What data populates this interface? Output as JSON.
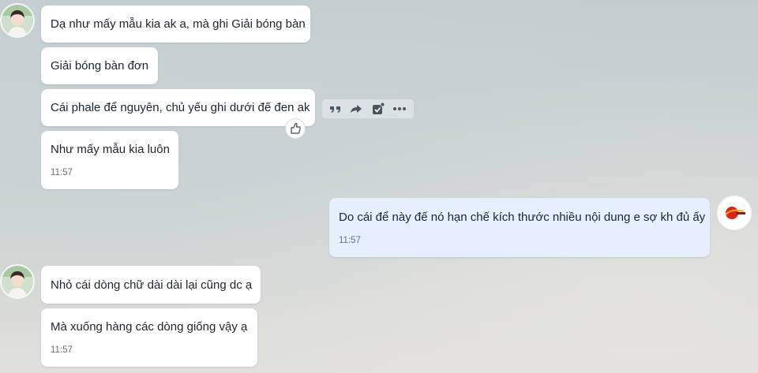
{
  "messages": [
    {
      "text": "Dạ như mấy mẫu kia ak a, mà ghi Giải bóng bàn"
    },
    {
      "text": "Giải bóng bàn đơn"
    },
    {
      "text": "Cái phale để nguyên, chủ yếu ghi dưới đế đen ak"
    },
    {
      "text": "Như mấy mẫu kia luôn",
      "time": "11:57"
    },
    {
      "text": "Do cái để này đế nó hạn chế kích thước nhiều nội dung e sợ kh đủ ấy",
      "time": "11:57"
    },
    {
      "text": "Nhỏ cái dòng chữ dài dài lại cũng dc ạ"
    },
    {
      "text": "Mà xuống hàng các dòng giống vậy ạ",
      "time": "11:57"
    }
  ],
  "toolbar": {
    "icons": [
      "quote-icon",
      "forward-icon",
      "task-icon",
      "more-icon"
    ]
  },
  "reaction": {
    "icon": "thumbs-up-icon"
  },
  "colors": {
    "incoming_bubble": "#ffffff",
    "outgoing_bubble": "#e5efff",
    "text": "#1c2430",
    "time": "#6b7178"
  }
}
